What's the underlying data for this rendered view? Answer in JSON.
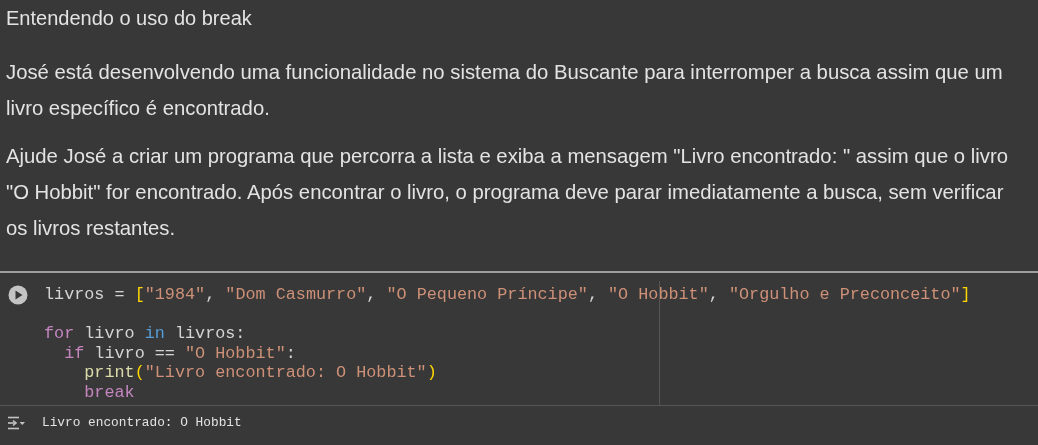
{
  "title": "Entendendo o uso do break",
  "paragraphs": [
    "José está desenvolvendo uma funcionalidade no sistema do Buscante para interromper a busca assim que um livro específico é encontrado.",
    "Ajude José a criar um programa que percorra a lista e exiba a mensagem \"Livro encontrado: \" assim que o livro \"O Hobbit\" for encontrado. Após encontrar o livro, o programa deve parar imediatamente a busca, sem verificar os livros restantes."
  ],
  "code_cell": {
    "statements": [
      {
        "tokens": [
          {
            "kind": "plain",
            "text": "livros = "
          },
          {
            "kind": "bracket",
            "text": "["
          },
          {
            "kind": "string",
            "text": "\"1984\""
          },
          {
            "kind": "plain",
            "text": ", "
          },
          {
            "kind": "string",
            "text": "\"Dom Casmurro\""
          },
          {
            "kind": "plain",
            "text": ", "
          },
          {
            "kind": "string",
            "text": "\"O Pequeno Príncipe\""
          },
          {
            "kind": "plain",
            "text": ", "
          },
          {
            "kind": "string",
            "text": "\"O Hobbit\""
          },
          {
            "kind": "plain",
            "text": ", "
          },
          {
            "kind": "string",
            "text": "\"Orgulho e Preconceito\""
          },
          {
            "kind": "bracket",
            "text": "]"
          }
        ]
      },
      {
        "tokens": [
          {
            "kind": "keyword",
            "text": "for"
          },
          {
            "kind": "plain",
            "text": " livro "
          },
          {
            "kind": "operator",
            "text": "in"
          },
          {
            "kind": "plain",
            "text": " livros:"
          }
        ],
        "children": [
          {
            "tokens": [
              {
                "kind": "keyword",
                "text": "if"
              },
              {
                "kind": "plain",
                "text": " livro == "
              },
              {
                "kind": "string",
                "text": "\"O Hobbit\""
              },
              {
                "kind": "plain",
                "text": ":"
              }
            ],
            "children": [
              {
                "tokens": [
                  {
                    "kind": "function",
                    "text": "print"
                  },
                  {
                    "kind": "bracket",
                    "text": "("
                  },
                  {
                    "kind": "string",
                    "text": "\"Livro encontrado: O Hobbit\""
                  },
                  {
                    "kind": "bracket",
                    "text": ")"
                  }
                ]
              },
              {
                "tokens": [
                  {
                    "kind": "keyword",
                    "text": "break"
                  }
                ]
              }
            ]
          }
        ]
      }
    ],
    "output": "Livro encontrado: O Hobbit"
  }
}
